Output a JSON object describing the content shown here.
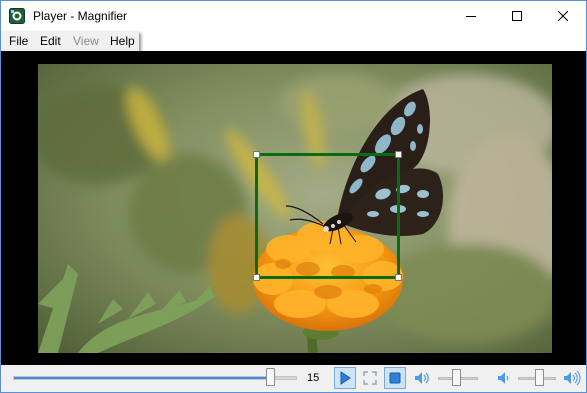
{
  "window": {
    "title": "Player - Magnifier",
    "app_icon": "player-app-icon",
    "controls": [
      "minimize-icon",
      "maximize-icon",
      "close-icon"
    ]
  },
  "menu": {
    "items": [
      {
        "label": "File",
        "enabled": true
      },
      {
        "label": "Edit",
        "enabled": true
      },
      {
        "label": "View",
        "enabled": false
      },
      {
        "label": "Help",
        "enabled": true
      }
    ]
  },
  "video": {
    "content": "butterfly on orange marigold flower",
    "magnifier_color": "#0c6b12"
  },
  "controls": {
    "seek_position_fraction": 0.91,
    "seek_value": "15",
    "buttons": [
      {
        "icon": "play-icon",
        "pressed": true
      },
      {
        "icon": "fullscreen-icon",
        "pressed": false
      },
      {
        "icon": "stop-icon",
        "pressed": false
      },
      {
        "icon": "speaker-icon",
        "pressed": false
      },
      {
        "icon": "speaker-low-icon",
        "pressed": false
      },
      {
        "icon": "speaker-high-icon",
        "pressed": false
      }
    ],
    "slider_a_fraction": 0.45,
    "slider_b_fraction": 0.55,
    "accent_color": "#3b8fde"
  }
}
